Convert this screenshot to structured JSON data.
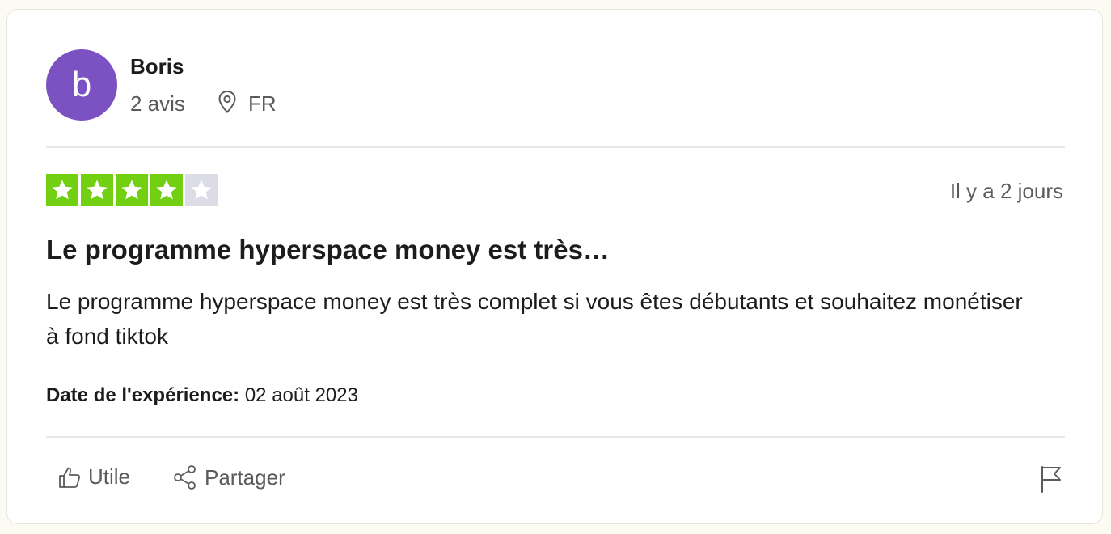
{
  "reviewer": {
    "avatar_letter": "b",
    "avatar_color": "#7c51c1",
    "name": "Boris",
    "review_count": "2 avis",
    "location": "FR",
    "location_icon": "map-pin-icon"
  },
  "review": {
    "rating": 4,
    "max_rating": 5,
    "star_filled_color": "#73cf11",
    "star_empty_color": "#dcdce6",
    "date": "Il y a 2 jours",
    "title": "Le programme hyperspace money est très…",
    "body": "Le programme hyperspace money est très complet si vous êtes débutants et souhaitez monétiser à fond tiktok",
    "experience_label": "Date de l'expérience:",
    "experience_date": "02 août 2023"
  },
  "actions": {
    "useful_label": "Utile",
    "useful_icon": "thumbs-up-icon",
    "share_label": "Partager",
    "share_icon": "share-icon",
    "report_icon": "flag-icon"
  }
}
